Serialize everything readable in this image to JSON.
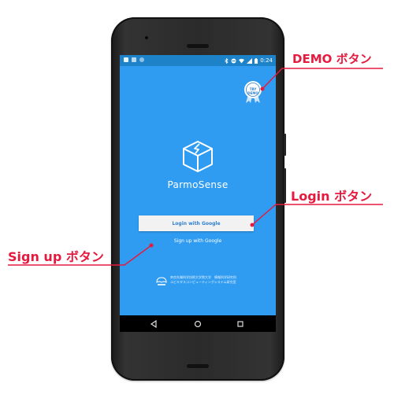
{
  "status_bar": {
    "time": "0:24"
  },
  "app": {
    "brand_name": "ParmoSense",
    "demo_badge": {
      "line1": "TRY",
      "line2": "DEMO"
    },
    "login_button_label": "Login with Google",
    "signup_link_label": "Sign up with Google",
    "footer_line1": "奈良先端科学技術大学院大学　情報科学研究科",
    "footer_line2": "ユビキタスコンピューティングシステム研究室"
  },
  "annotations": {
    "demo": "DEMO ボタン",
    "login": "Login ボタン",
    "signup": "Sign up ボタン"
  },
  "colors": {
    "app_background": "#2f9cf2",
    "status_bar": "#1e82c8",
    "callout": "#e51a3e"
  },
  "icons": [
    "back-icon",
    "home-icon",
    "recents-icon",
    "bluetooth-icon",
    "wifi-icon",
    "battery-icon"
  ]
}
